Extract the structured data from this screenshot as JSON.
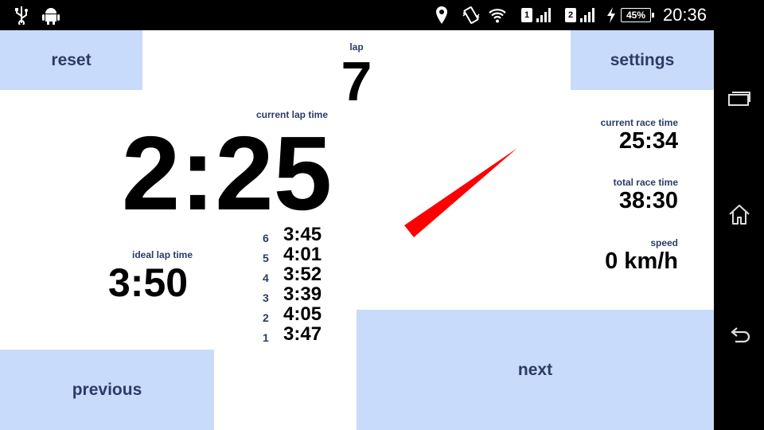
{
  "status_bar": {
    "icons": [
      "usb-icon",
      "android-icon",
      "location-icon",
      "vibrate-icon",
      "wifi-icon",
      "signal-sim1-icon",
      "signal-sim2-icon",
      "charging-icon",
      "battery-icon"
    ],
    "sim1": "1",
    "sim2": "2",
    "battery": "45%",
    "time": "20:36"
  },
  "buttons": {
    "reset": "reset",
    "settings": "settings",
    "previous": "previous",
    "next": "next"
  },
  "lap": {
    "label": "lap",
    "value": "7"
  },
  "current_lap": {
    "label": "current lap time",
    "value": "2:25"
  },
  "ideal_lap": {
    "label": "ideal lap time",
    "value": "3:50"
  },
  "lap_history": [
    {
      "lap": "6",
      "time": "3:45"
    },
    {
      "lap": "5",
      "time": "4:01"
    },
    {
      "lap": "4",
      "time": "3:52"
    },
    {
      "lap": "3",
      "time": "3:39"
    },
    {
      "lap": "2",
      "time": "4:05"
    },
    {
      "lap": "1",
      "time": "3:47"
    }
  ],
  "current_race": {
    "label": "current race time",
    "value": "25:34"
  },
  "total_race": {
    "label": "total race time",
    "value": "38:30"
  },
  "speed": {
    "label": "speed",
    "value": "0 km/h"
  },
  "colors": {
    "button_bg": "#c9dbfa",
    "label": "#2c3b66",
    "needle": "#ff0000"
  },
  "nav_bar": {
    "icons": [
      "recent-apps-icon",
      "home-icon",
      "back-icon"
    ]
  }
}
